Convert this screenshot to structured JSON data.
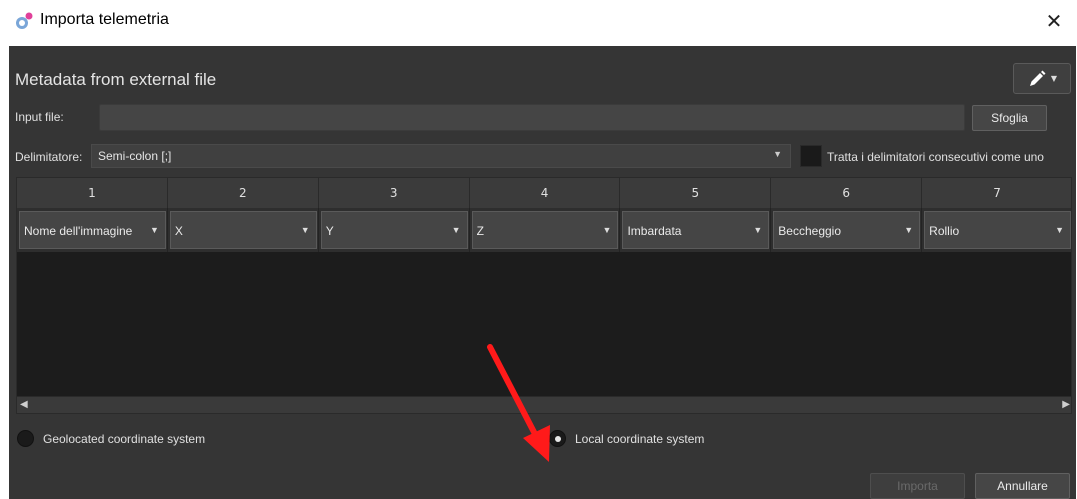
{
  "window": {
    "title": "Importa telemetria",
    "close_glyph": "✕"
  },
  "section": {
    "title": "Metadata from external file",
    "tool_icon": "pencil-icon"
  },
  "input_file": {
    "label": "Input file:",
    "value": "",
    "browse_label": "Sfoglia"
  },
  "delimiter": {
    "label": "Delimitatore:",
    "value": "Semi-colon [;]",
    "consecutive_label": "Tratta i delimitatori consecutivi come uno",
    "consecutive_checked": false
  },
  "table": {
    "columns": [
      {
        "index": "1",
        "field": "Nome dell'immagine"
      },
      {
        "index": "2",
        "field": "X"
      },
      {
        "index": "3",
        "field": "Y"
      },
      {
        "index": "4",
        "field": "Z"
      },
      {
        "index": "5",
        "field": "Imbardata"
      },
      {
        "index": "6",
        "field": "Beccheggio"
      },
      {
        "index": "7",
        "field": "Rollio"
      }
    ]
  },
  "coordinate_system": {
    "geolocated_label": "Geolocated coordinate system",
    "local_label": "Local coordinate system",
    "selected": "local"
  },
  "footer": {
    "import_label": "Importa",
    "import_enabled": false,
    "cancel_label": "Annullare"
  },
  "colors": {
    "dialog_bg": "#353535",
    "table_bg": "#1c1c1c",
    "annotation_arrow": "#ff1a1a"
  }
}
